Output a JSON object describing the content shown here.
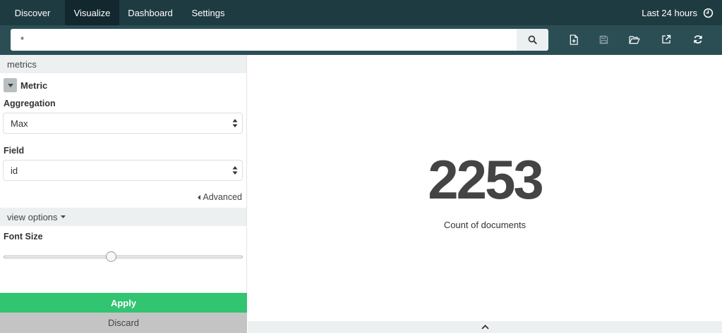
{
  "nav": {
    "tabs": [
      {
        "label": "Discover"
      },
      {
        "label": "Visualize"
      },
      {
        "label": "Dashboard"
      },
      {
        "label": "Settings"
      }
    ],
    "active_tab": "Visualize",
    "time_range": "Last 24 hours",
    "time_icon": "clock-icon"
  },
  "search": {
    "value": "*",
    "button_icon": "search-icon"
  },
  "toolbar": {
    "icons": [
      "new-visualization-icon",
      "save-icon",
      "open-icon",
      "share-icon",
      "refresh-icon"
    ]
  },
  "sidebar": {
    "metrics_header": "metrics",
    "metric_title": "Metric",
    "aggregation_label": "Aggregation",
    "aggregation_value": "Max",
    "field_label": "Field",
    "field_value": "id",
    "advanced_label": "Advanced",
    "view_options_header": "view options",
    "font_size_label": "Font Size",
    "font_size_fraction": 0.45,
    "apply_label": "Apply",
    "discard_label": "Discard"
  },
  "visualization": {
    "value": "2253",
    "label": "Count of documents"
  },
  "colors": {
    "nav_bg": "#1f3b42",
    "search_bar_bg": "#2b4e55",
    "apply_green": "#31c471",
    "discard_gray": "#c4c4c4"
  }
}
